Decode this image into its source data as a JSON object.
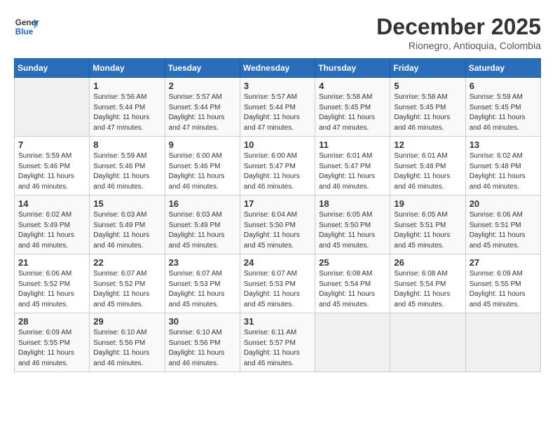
{
  "header": {
    "logo_line1": "General",
    "logo_line2": "Blue",
    "title": "December 2025",
    "subtitle": "Rionegro, Antioquia, Colombia"
  },
  "weekdays": [
    "Sunday",
    "Monday",
    "Tuesday",
    "Wednesday",
    "Thursday",
    "Friday",
    "Saturday"
  ],
  "weeks": [
    [
      {
        "day": "",
        "info": ""
      },
      {
        "day": "1",
        "info": "Sunrise: 5:56 AM\nSunset: 5:44 PM\nDaylight: 11 hours\nand 47 minutes."
      },
      {
        "day": "2",
        "info": "Sunrise: 5:57 AM\nSunset: 5:44 PM\nDaylight: 11 hours\nand 47 minutes."
      },
      {
        "day": "3",
        "info": "Sunrise: 5:57 AM\nSunset: 5:44 PM\nDaylight: 11 hours\nand 47 minutes."
      },
      {
        "day": "4",
        "info": "Sunrise: 5:58 AM\nSunset: 5:45 PM\nDaylight: 11 hours\nand 47 minutes."
      },
      {
        "day": "5",
        "info": "Sunrise: 5:58 AM\nSunset: 5:45 PM\nDaylight: 11 hours\nand 46 minutes."
      },
      {
        "day": "6",
        "info": "Sunrise: 5:59 AM\nSunset: 5:45 PM\nDaylight: 11 hours\nand 46 minutes."
      }
    ],
    [
      {
        "day": "7",
        "info": "Sunrise: 5:59 AM\nSunset: 5:46 PM\nDaylight: 11 hours\nand 46 minutes."
      },
      {
        "day": "8",
        "info": "Sunrise: 5:59 AM\nSunset: 5:46 PM\nDaylight: 11 hours\nand 46 minutes."
      },
      {
        "day": "9",
        "info": "Sunrise: 6:00 AM\nSunset: 5:46 PM\nDaylight: 11 hours\nand 46 minutes."
      },
      {
        "day": "10",
        "info": "Sunrise: 6:00 AM\nSunset: 5:47 PM\nDaylight: 11 hours\nand 46 minutes."
      },
      {
        "day": "11",
        "info": "Sunrise: 6:01 AM\nSunset: 5:47 PM\nDaylight: 11 hours\nand 46 minutes."
      },
      {
        "day": "12",
        "info": "Sunrise: 6:01 AM\nSunset: 5:48 PM\nDaylight: 11 hours\nand 46 minutes."
      },
      {
        "day": "13",
        "info": "Sunrise: 6:02 AM\nSunset: 5:48 PM\nDaylight: 11 hours\nand 46 minutes."
      }
    ],
    [
      {
        "day": "14",
        "info": "Sunrise: 6:02 AM\nSunset: 5:49 PM\nDaylight: 11 hours\nand 46 minutes."
      },
      {
        "day": "15",
        "info": "Sunrise: 6:03 AM\nSunset: 5:49 PM\nDaylight: 11 hours\nand 46 minutes."
      },
      {
        "day": "16",
        "info": "Sunrise: 6:03 AM\nSunset: 5:49 PM\nDaylight: 11 hours\nand 45 minutes."
      },
      {
        "day": "17",
        "info": "Sunrise: 6:04 AM\nSunset: 5:50 PM\nDaylight: 11 hours\nand 45 minutes."
      },
      {
        "day": "18",
        "info": "Sunrise: 6:05 AM\nSunset: 5:50 PM\nDaylight: 11 hours\nand 45 minutes."
      },
      {
        "day": "19",
        "info": "Sunrise: 6:05 AM\nSunset: 5:51 PM\nDaylight: 11 hours\nand 45 minutes."
      },
      {
        "day": "20",
        "info": "Sunrise: 6:06 AM\nSunset: 5:51 PM\nDaylight: 11 hours\nand 45 minutes."
      }
    ],
    [
      {
        "day": "21",
        "info": "Sunrise: 6:06 AM\nSunset: 5:52 PM\nDaylight: 11 hours\nand 45 minutes."
      },
      {
        "day": "22",
        "info": "Sunrise: 6:07 AM\nSunset: 5:52 PM\nDaylight: 11 hours\nand 45 minutes."
      },
      {
        "day": "23",
        "info": "Sunrise: 6:07 AM\nSunset: 5:53 PM\nDaylight: 11 hours\nand 45 minutes."
      },
      {
        "day": "24",
        "info": "Sunrise: 6:07 AM\nSunset: 5:53 PM\nDaylight: 11 hours\nand 45 minutes."
      },
      {
        "day": "25",
        "info": "Sunrise: 6:08 AM\nSunset: 5:54 PM\nDaylight: 11 hours\nand 45 minutes."
      },
      {
        "day": "26",
        "info": "Sunrise: 6:08 AM\nSunset: 5:54 PM\nDaylight: 11 hours\nand 45 minutes."
      },
      {
        "day": "27",
        "info": "Sunrise: 6:09 AM\nSunset: 5:55 PM\nDaylight: 11 hours\nand 45 minutes."
      }
    ],
    [
      {
        "day": "28",
        "info": "Sunrise: 6:09 AM\nSunset: 5:55 PM\nDaylight: 11 hours\nand 46 minutes."
      },
      {
        "day": "29",
        "info": "Sunrise: 6:10 AM\nSunset: 5:56 PM\nDaylight: 11 hours\nand 46 minutes."
      },
      {
        "day": "30",
        "info": "Sunrise: 6:10 AM\nSunset: 5:56 PM\nDaylight: 11 hours\nand 46 minutes."
      },
      {
        "day": "31",
        "info": "Sunrise: 6:11 AM\nSunset: 5:57 PM\nDaylight: 11 hours\nand 46 minutes."
      },
      {
        "day": "",
        "info": ""
      },
      {
        "day": "",
        "info": ""
      },
      {
        "day": "",
        "info": ""
      }
    ]
  ]
}
